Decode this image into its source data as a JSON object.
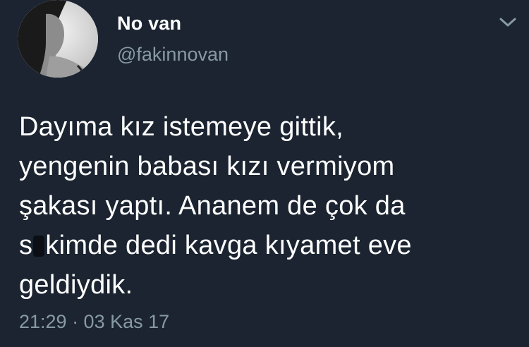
{
  "user": {
    "display_name": "No van",
    "handle": "@fakinnovan"
  },
  "tweet": {
    "lines": [
      "Dayıma kız istemeye gittik,",
      "yengenin babası kızı vermiyom",
      "şakası yaptı. Ananem de çok da",
      "s",
      "kimde dedi kavga kıyamet eve",
      "geldiydik."
    ],
    "timestamp": "21:29 · 03 Kas 17"
  },
  "icons": {
    "menu_caret": "chevron-down-icon",
    "avatar": "avatar"
  },
  "colors": {
    "background": "#1b2430",
    "primary_text": "#ffffff",
    "secondary_text": "#8899a6"
  }
}
